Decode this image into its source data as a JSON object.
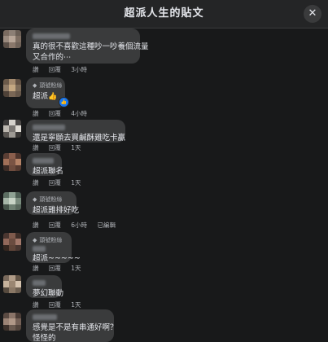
{
  "header": {
    "title": "超派人生的貼文",
    "close_icon": "close-icon"
  },
  "comments": [
    {
      "text_lines": [
        "真的很不喜歡這種吵一吵養個流量",
        "又合作的⋯"
      ],
      "actions": [
        "讚",
        "回覆",
        "3小時"
      ],
      "badge": ""
    },
    {
      "text_lines": [
        "超派"
      ],
      "emoji": "👍",
      "actions": [
        "讚",
        "回覆",
        "4小時"
      ],
      "badge": "頭號粉絲",
      "reaction": "like"
    },
    {
      "text_lines": [
        "還是寧願去買鹹酥雞吃卡贏"
      ],
      "actions": [
        "讚",
        "回覆",
        "1天"
      ],
      "badge": ""
    },
    {
      "text_lines": [
        "超派聯名"
      ],
      "actions": [
        "讚",
        "回覆",
        "1天"
      ],
      "badge": ""
    },
    {
      "text_lines": [
        "超派雞排好吃"
      ],
      "actions": [
        "讚",
        "回覆",
        "6小時",
        "已編輯"
      ],
      "badge": "頭號粉絲"
    },
    {
      "text_lines": [
        "超派~~~~~"
      ],
      "actions": [
        "讚",
        "回覆",
        "1天"
      ],
      "badge": "頭號粉絲"
    },
    {
      "text_lines": [
        "夢幻聯動"
      ],
      "actions": [
        "讚",
        "回覆",
        "1天"
      ],
      "badge": ""
    },
    {
      "text_lines": [
        "感覺是不是有串通好啊？",
        "怪怪的"
      ],
      "actions": [],
      "badge": ""
    }
  ],
  "colors": {
    "background": "#18191a",
    "bubble": "#3a3b3c",
    "meta_text": "#b0b3b8",
    "like_blue": "#1877f2"
  }
}
